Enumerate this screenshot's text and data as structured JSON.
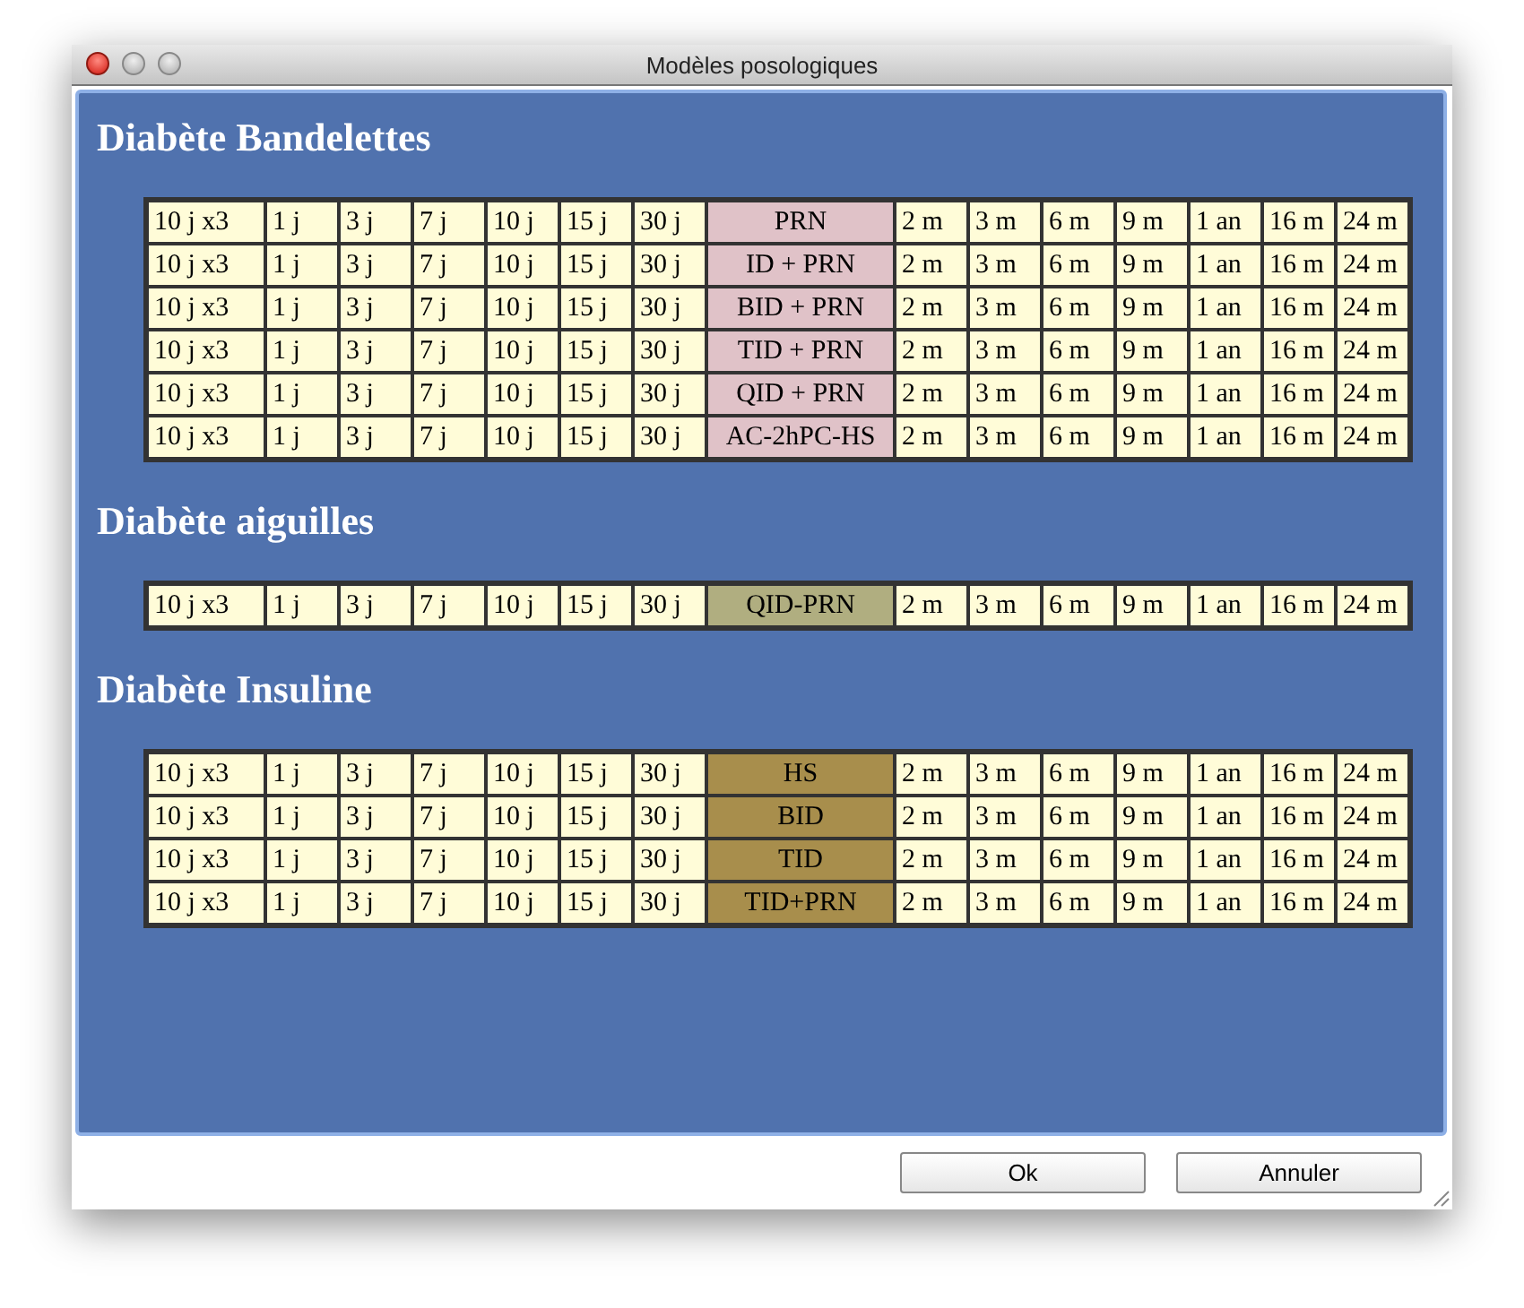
{
  "window": {
    "title": "Modèles posologiques"
  },
  "sections": [
    {
      "title": "Diabète Bandelettes",
      "color": "#e0c2c8",
      "rows": [
        {
          "durations": [
            "10 j x3",
            "1 j",
            "3 j",
            "7 j",
            "10 j",
            "15 j",
            "30 j"
          ],
          "regimen": "PRN",
          "periods": [
            "2 m",
            "3 m",
            "6 m",
            "9 m",
            "1 an",
            "16 m",
            "24 m"
          ]
        },
        {
          "durations": [
            "10 j x3",
            "1 j",
            "3 j",
            "7 j",
            "10 j",
            "15 j",
            "30 j"
          ],
          "regimen": "ID + PRN",
          "periods": [
            "2 m",
            "3 m",
            "6 m",
            "9 m",
            "1 an",
            "16 m",
            "24 m"
          ]
        },
        {
          "durations": [
            "10 j x3",
            "1 j",
            "3 j",
            "7 j",
            "10 j",
            "15 j",
            "30 j"
          ],
          "regimen": "BID + PRN",
          "periods": [
            "2 m",
            "3 m",
            "6 m",
            "9 m",
            "1 an",
            "16 m",
            "24 m"
          ]
        },
        {
          "durations": [
            "10 j x3",
            "1 j",
            "3 j",
            "7 j",
            "10 j",
            "15 j",
            "30 j"
          ],
          "regimen": "TID + PRN",
          "periods": [
            "2 m",
            "3 m",
            "6 m",
            "9 m",
            "1 an",
            "16 m",
            "24 m"
          ]
        },
        {
          "durations": [
            "10 j x3",
            "1 j",
            "3 j",
            "7 j",
            "10 j",
            "15 j",
            "30 j"
          ],
          "regimen": "QID + PRN",
          "periods": [
            "2 m",
            "3 m",
            "6 m",
            "9 m",
            "1 an",
            "16 m",
            "24 m"
          ]
        },
        {
          "durations": [
            "10 j x3",
            "1 j",
            "3 j",
            "7 j",
            "10 j",
            "15 j",
            "30 j"
          ],
          "regimen": "AC-2hPC-HS",
          "periods": [
            "2 m",
            "3 m",
            "6 m",
            "9 m",
            "1 an",
            "16 m",
            "24 m"
          ]
        }
      ]
    },
    {
      "title": "Diabète aiguilles",
      "color": "#b0ae80",
      "rows": [
        {
          "durations": [
            "10 j x3",
            "1 j",
            "3 j",
            "7 j",
            "10 j",
            "15 j",
            "30 j"
          ],
          "regimen": "QID-PRN",
          "periods": [
            "2 m",
            "3 m",
            "6 m",
            "9 m",
            "1 an",
            "16 m",
            "24 m"
          ]
        }
      ]
    },
    {
      "title": "Diabète Insuline",
      "color": "#a88e4c",
      "rows": [
        {
          "durations": [
            "10 j x3",
            "1 j",
            "3 j",
            "7 j",
            "10 j",
            "15 j",
            "30 j"
          ],
          "regimen": "HS",
          "periods": [
            "2 m",
            "3 m",
            "6 m",
            "9 m",
            "1 an",
            "16 m",
            "24 m"
          ]
        },
        {
          "durations": [
            "10 j x3",
            "1 j",
            "3 j",
            "7 j",
            "10 j",
            "15 j",
            "30 j"
          ],
          "regimen": "BID",
          "periods": [
            "2 m",
            "3 m",
            "6 m",
            "9 m",
            "1 an",
            "16 m",
            "24 m"
          ]
        },
        {
          "durations": [
            "10 j x3",
            "1 j",
            "3 j",
            "7 j",
            "10 j",
            "15 j",
            "30 j"
          ],
          "regimen": "TID",
          "periods": [
            "2 m",
            "3 m",
            "6 m",
            "9 m",
            "1 an",
            "16 m",
            "24 m"
          ]
        },
        {
          "durations": [
            "10 j x3",
            "1 j",
            "3 j",
            "7 j",
            "10 j",
            "15 j",
            "30 j"
          ],
          "regimen": "TID+PRN",
          "periods": [
            "2 m",
            "3 m",
            "6 m",
            "9 m",
            "1 an",
            "16 m",
            "24 m"
          ]
        }
      ]
    }
  ],
  "buttons": [
    "Ok",
    "Annuler"
  ]
}
